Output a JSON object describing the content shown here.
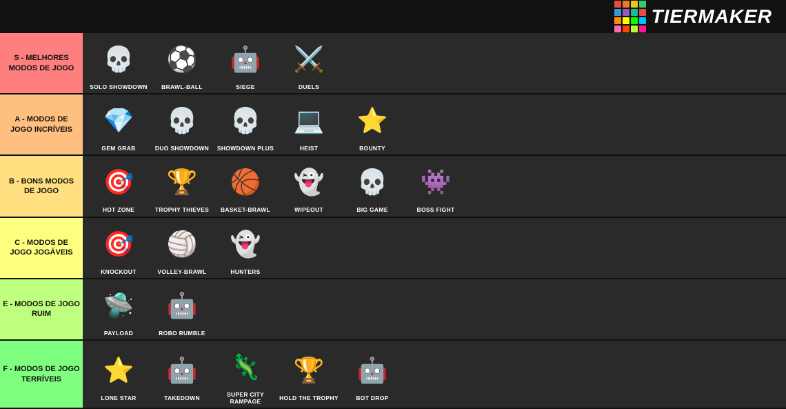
{
  "header": {
    "logo_text": "TiERMAKER",
    "logo_colors": [
      "#e74c3c",
      "#e67e22",
      "#f1c40f",
      "#2ecc71",
      "#3498db",
      "#9b59b6",
      "#1abc9c",
      "#e74c3c",
      "#ff8c00",
      "#ffff00",
      "#00ff00",
      "#00bfff",
      "#ff69b4",
      "#ff4500",
      "#adff2f",
      "#ff1493"
    ]
  },
  "tiers": [
    {
      "id": "S",
      "label": "S - MELHORES MODOS DE JOGO",
      "color": "#ff7f7f",
      "items": [
        {
          "id": "solo-showdown",
          "label": "SOLO\nSHOWDOWN",
          "emoji": "💀"
        },
        {
          "id": "brawl-ball",
          "label": "BRAWL-BALL",
          "emoji": "⚽"
        },
        {
          "id": "siege",
          "label": "SIEGE",
          "emoji": "🤖"
        },
        {
          "id": "duels",
          "label": "DUELS",
          "emoji": "⚔️"
        }
      ]
    },
    {
      "id": "A",
      "label": "A - MODOS DE JOGO INCRÍVEIS",
      "color": "#ffbf7f",
      "items": [
        {
          "id": "gem-grab",
          "label": "GEM GRAB",
          "emoji": "💎"
        },
        {
          "id": "duo-showdown",
          "label": "DUO\nSHOWDOWN",
          "emoji": "💀"
        },
        {
          "id": "showdown-plus",
          "label": "SHOWDOWN\nPLUS",
          "emoji": "💀"
        },
        {
          "id": "heist",
          "label": "HEIST",
          "emoji": "💻"
        },
        {
          "id": "bounty",
          "label": "BOUNTY",
          "emoji": "⭐"
        }
      ]
    },
    {
      "id": "B",
      "label": "B - BONS MODOS DE JOGO",
      "color": "#ffdf7f",
      "items": [
        {
          "id": "hot-zone",
          "label": "HOT ZONE",
          "emoji": "🎯"
        },
        {
          "id": "trophy-thieves",
          "label": "TROPHY\nTHIEVES",
          "emoji": "🏆"
        },
        {
          "id": "basket-brawl",
          "label": "BASKET-BRAWL",
          "emoji": "🏀"
        },
        {
          "id": "wipeout",
          "label": "WIPEOUT",
          "emoji": "👻"
        },
        {
          "id": "big-game",
          "label": "BIG GAME",
          "emoji": "💀"
        },
        {
          "id": "boss-fight",
          "label": "BOSS FIGHT",
          "emoji": "👾"
        }
      ]
    },
    {
      "id": "C",
      "label": "C - MODOS DE JOGO JOGÁVEIS",
      "color": "#ffff7f",
      "items": [
        {
          "id": "knockout",
          "label": "KNOCKOUT",
          "emoji": "🎯"
        },
        {
          "id": "volley-brawl",
          "label": "VOLLEY-BRAWL",
          "emoji": "🏐"
        },
        {
          "id": "hunters",
          "label": "HUNTERS",
          "emoji": "👻"
        }
      ]
    },
    {
      "id": "E",
      "label": "E - MODOS DE JOGO RUIM",
      "color": "#bfff7f",
      "items": [
        {
          "id": "payload",
          "label": "PAYLOAD",
          "emoji": "🛸"
        },
        {
          "id": "robo-rumble",
          "label": "ROBO RUMBLE",
          "emoji": "🤖"
        }
      ]
    },
    {
      "id": "F",
      "label": "F - MODOS DE JOGO TERRÍVEIS",
      "color": "#7fff7f",
      "items": [
        {
          "id": "lone-star",
          "label": "LONE STAR",
          "emoji": "⭐"
        },
        {
          "id": "takedown",
          "label": "TAKEDOWN",
          "emoji": "🤖"
        },
        {
          "id": "super-city-rampage",
          "label": "SUPER CITY\nRAMPAGE",
          "emoji": "🦎"
        },
        {
          "id": "hold-the-trophy",
          "label": "HOLD THE\nTROPHY",
          "emoji": "🏆"
        },
        {
          "id": "bot-drop",
          "label": "BOT DROP",
          "emoji": "🤖"
        }
      ]
    }
  ]
}
